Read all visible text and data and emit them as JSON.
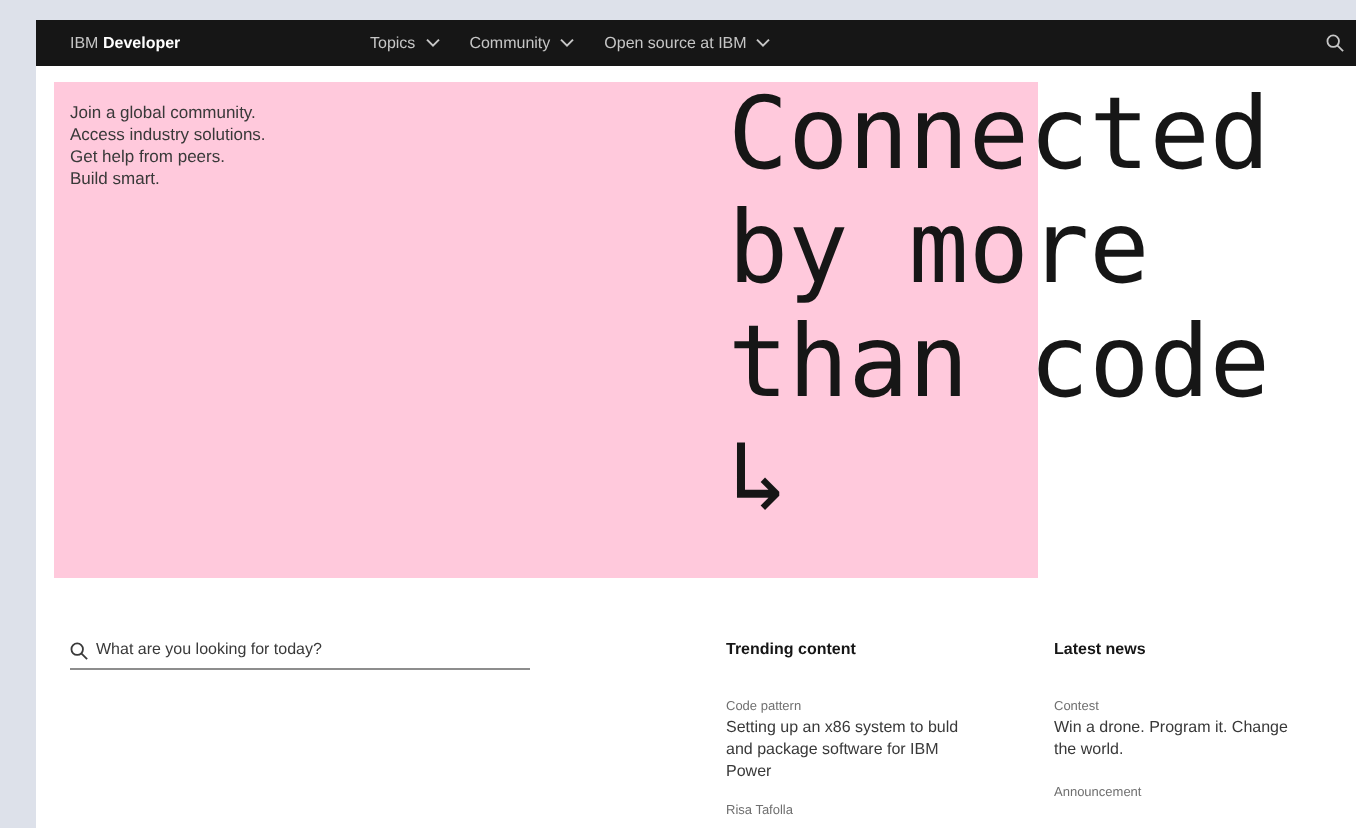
{
  "nav": {
    "brand_prefix": "IBM",
    "brand_name": "Developer",
    "menus": [
      {
        "label": "Topics"
      },
      {
        "label": "Community"
      },
      {
        "label": "Open source at IBM"
      }
    ]
  },
  "hero": {
    "intro": [
      "Join a global community.",
      "Access industry solutions.",
      "Get help from peers.",
      "Build smart."
    ],
    "headline": [
      "Connected",
      "by more",
      "than code",
      "↳"
    ]
  },
  "search": {
    "placeholder": "What are you looking for today?"
  },
  "trending": {
    "title": "Trending content",
    "items": [
      {
        "category": "Code pattern",
        "title": "Setting up an x86 system to buld and package software for IBM Power",
        "author": "Risa Tafolla"
      }
    ]
  },
  "news": {
    "title": "Latest news",
    "items": [
      {
        "category": "Contest",
        "title": "Win a drone. Program it. Change the world."
      },
      {
        "category": "Announcement"
      }
    ]
  }
}
